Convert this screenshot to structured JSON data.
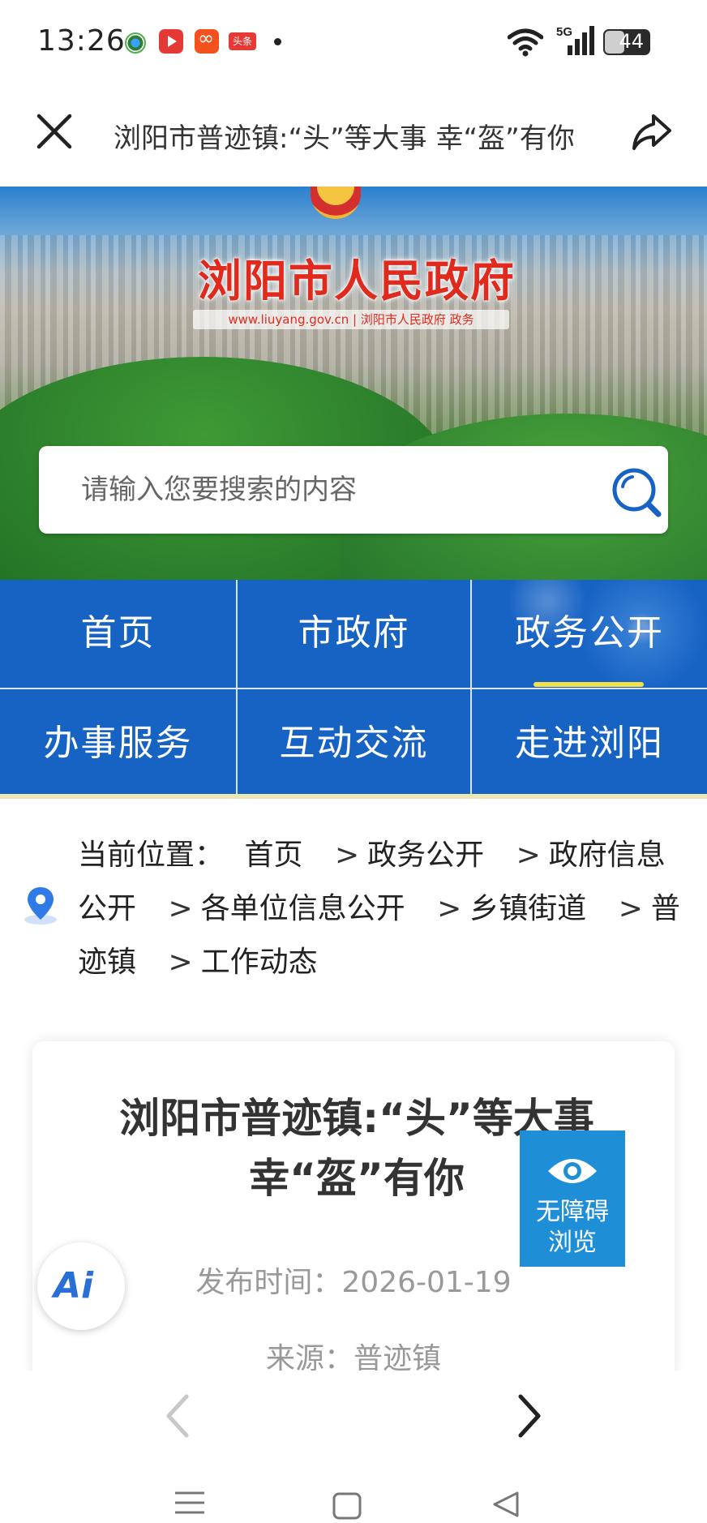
{
  "status_bar": {
    "time": "13:26",
    "network": "5G",
    "battery": "44",
    "battery_fraction": 0.44,
    "app_badge": "头条"
  },
  "top_nav": {
    "title": "浏阳市普迹镇:“头”等大事 幸“盔”有你"
  },
  "banner": {
    "gov_title": "浏阳市人民政府",
    "gov_subtitle": "www.liuyang.gov.cn | 浏阳市人民政府 政务",
    "search": {
      "placeholder": "请输入您要搜索的内容"
    }
  },
  "menu": {
    "items": [
      {
        "label": "首页"
      },
      {
        "label": "市政府"
      },
      {
        "label": "政务公开",
        "active": true
      },
      {
        "label": "办事服务"
      },
      {
        "label": "互动交流"
      },
      {
        "label": "走进浏阳"
      }
    ]
  },
  "breadcrumb": {
    "prefix": "当前位置：",
    "separator": ">",
    "items": [
      "首页",
      "政务公开",
      "政府信息公开",
      "各单位信息公开",
      "乡镇街道",
      "普迹镇",
      "工作动态"
    ]
  },
  "article": {
    "title": "浏阳市普迹镇:“头”等大事 幸“盔”有你",
    "publish_time": "发布时间：2026-01-19",
    "source": "来源：普迹镇"
  },
  "accessibility": {
    "label_line1": "无障碍",
    "label_line2": "浏览"
  },
  "ai_button": {
    "label": "Ai"
  },
  "colors": {
    "menu_blue": "#1763c4",
    "active_underline": "#f5e24a",
    "gov_red": "#e02a1e",
    "access_blue": "#1e8fd6"
  }
}
